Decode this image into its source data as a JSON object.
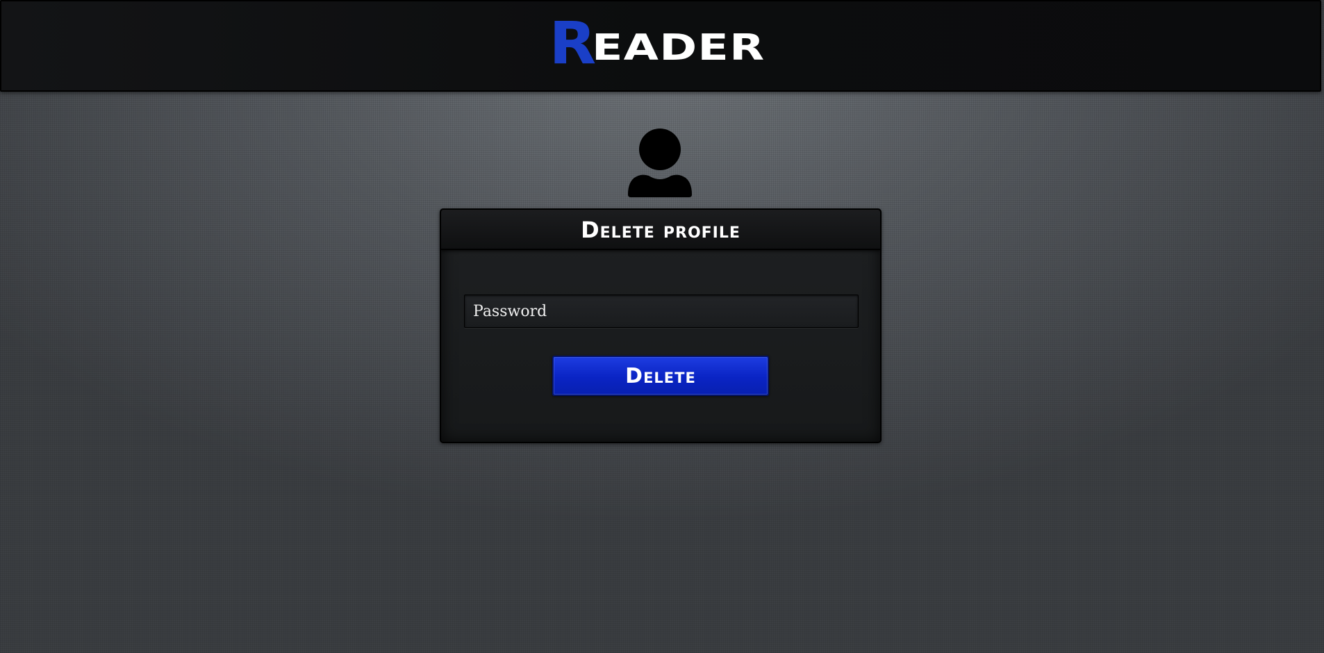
{
  "header": {
    "logo_initial": "R",
    "logo_rest": "EADER",
    "logo_accent_color": "#1a3fc7"
  },
  "profile": {
    "avatar_icon": "user-icon"
  },
  "panel": {
    "title": "Delete profile",
    "password_placeholder": "Password",
    "password_value": "",
    "delete_label": "Delete",
    "button_color": "#0a24c4"
  }
}
